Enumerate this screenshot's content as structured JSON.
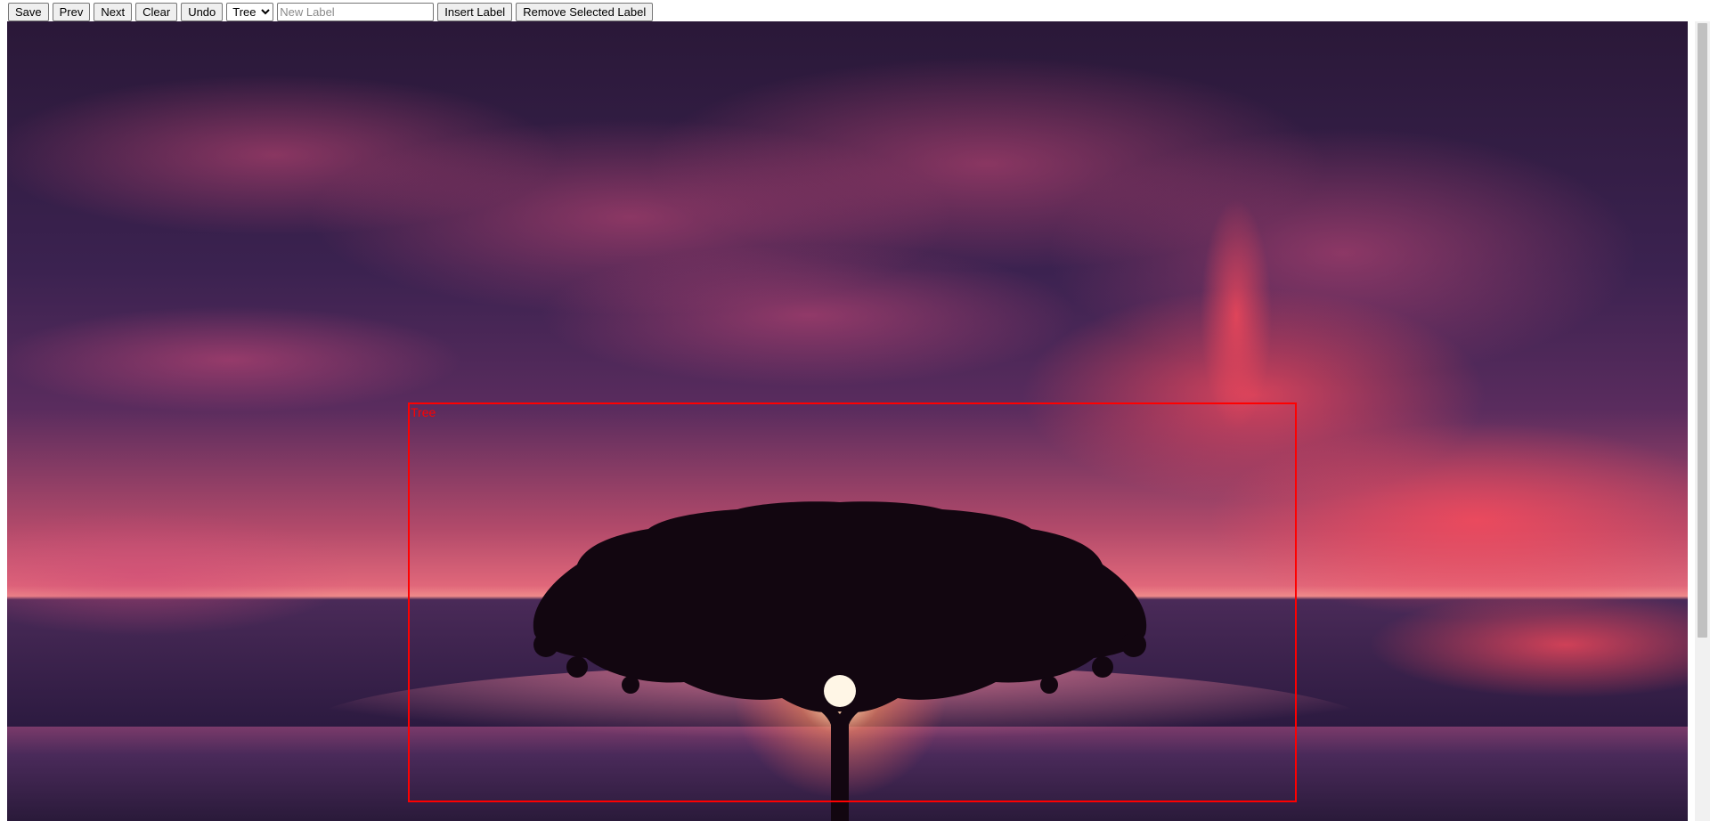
{
  "toolbar": {
    "save_label": "Save",
    "prev_label": "Prev",
    "next_label": "Next",
    "clear_label": "Clear",
    "undo_label": "Undo",
    "label_select": {
      "selected": "Tree",
      "options": [
        "Tree"
      ]
    },
    "new_label_input": {
      "value": "",
      "placeholder": "New Label"
    },
    "insert_label": "Insert Label",
    "remove_selected_label": "Remove Selected Label"
  },
  "annotations": [
    {
      "label": "Tree",
      "color": "#ff0000"
    }
  ],
  "image": {
    "subject": "tree-silhouette-sunset-over-sea"
  },
  "colors": {
    "annotation": "#ff0000"
  }
}
